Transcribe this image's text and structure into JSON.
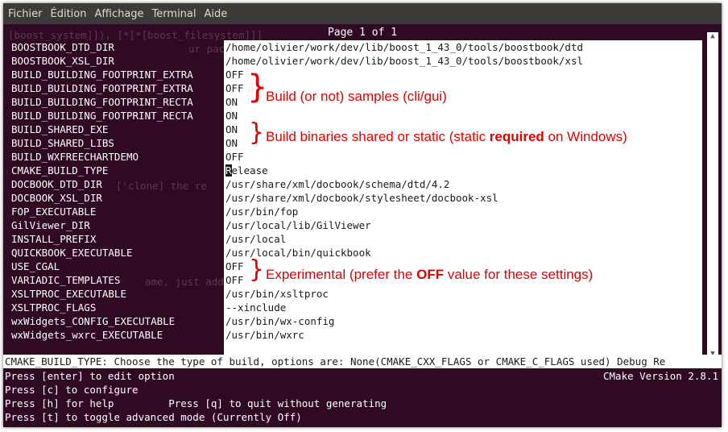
{
  "menu": [
    "Fichier",
    "Édition",
    "Affichage",
    "Terminal",
    "Aide"
  ],
  "page_indicator": "Page 1 of 1",
  "background_ghost": [
    "[boost_system]]), [*[*[boost_filesystem]]]",
    "ur packages ma",
    "['clone] the re",
    "ame, just add"
  ],
  "entries": [
    {
      "key": "BOOSTBOOK_DTD_DIR",
      "value": "/home/olivier/work/dev/lib/boost_1_43_0/tools/boostbook/dtd"
    },
    {
      "key": "BOOSTBOOK_XSL_DIR",
      "value": "/home/olivier/work/dev/lib/boost_1_43_0/tools/boostbook/xsl"
    },
    {
      "key": "BUILD_BUILDING_FOOTPRINT_EXTRA",
      "value": "OFF"
    },
    {
      "key": "BUILD_BUILDING_FOOTPRINT_EXTRA",
      "value": "OFF"
    },
    {
      "key": "BUILD_BUILDING_FOOTPRINT_RECTA",
      "value": "ON"
    },
    {
      "key": "BUILD_BUILDING_FOOTPRINT_RECTA",
      "value": "ON"
    },
    {
      "key": "BUILD_SHARED_EXE",
      "value": "ON"
    },
    {
      "key": "BUILD_SHARED_LIBS",
      "value": "ON"
    },
    {
      "key": "BUILD_WXFREECHARTDEMO",
      "value": "OFF"
    },
    {
      "key": "CMAKE_BUILD_TYPE",
      "value_cursor": "R",
      "value_rest": "elease"
    },
    {
      "key": "DOCBOOK_DTD_DIR",
      "value": "/usr/share/xml/docbook/schema/dtd/4.2"
    },
    {
      "key": "DOCBOOK_XSL_DIR",
      "value": "/usr/share/xml/docbook/stylesheet/docbook-xsl"
    },
    {
      "key": "FOP_EXECUTABLE",
      "value": "/usr/bin/fop"
    },
    {
      "key": "GilViewer_DIR",
      "value": "/usr/local/lib/GilViewer"
    },
    {
      "key": "INSTALL_PREFIX",
      "value": "/usr/local"
    },
    {
      "key": "QUICKBOOK_EXECUTABLE",
      "value": "/usr/local/bin/quickbook"
    },
    {
      "key": "USE_CGAL",
      "value": "OFF"
    },
    {
      "key": "VARIADIC_TEMPLATES",
      "value": "OFF"
    },
    {
      "key": "XSLTPROC_EXECUTABLE",
      "value": "/usr/bin/xsltproc"
    },
    {
      "key": "XSLTPROC_FLAGS",
      "value": "--xinclude"
    },
    {
      "key": "wxWidgets_CONFIG_EXECUTABLE",
      "value": "/usr/bin/wx-config"
    },
    {
      "key": "wxWidgets_wxrc_EXECUTABLE",
      "value": "/usr/bin/wxrc"
    }
  ],
  "annotations": {
    "samples": "Build (or not) samples (cli/gui)",
    "shared_pre": "Build binaries shared or static (static ",
    "shared_bold": "required",
    "shared_post": " on Windows)",
    "experimental_pre": "Experimental (prefer the ",
    "experimental_bold": "OFF",
    "experimental_post": " value for these settings)"
  },
  "description": "CMAKE_BUILD_TYPE: Choose the type of build, options are: None(CMAKE_CXX_FLAGS or CMAKE_C_FLAGS used) Debug Re",
  "help": {
    "enter": "Press [enter] to edit option",
    "version": "CMake Version 2.8.1",
    "configure": "Press [c] to configure",
    "help": "Press [h] for help         Press [q] to quit without generating",
    "toggle": "Press [t] to toggle advanced mode (Currently Off)"
  },
  "colors": {
    "terminal_bg": "#300a24",
    "menubar_bg": "#3c3b37",
    "annotation": "#e00000"
  }
}
